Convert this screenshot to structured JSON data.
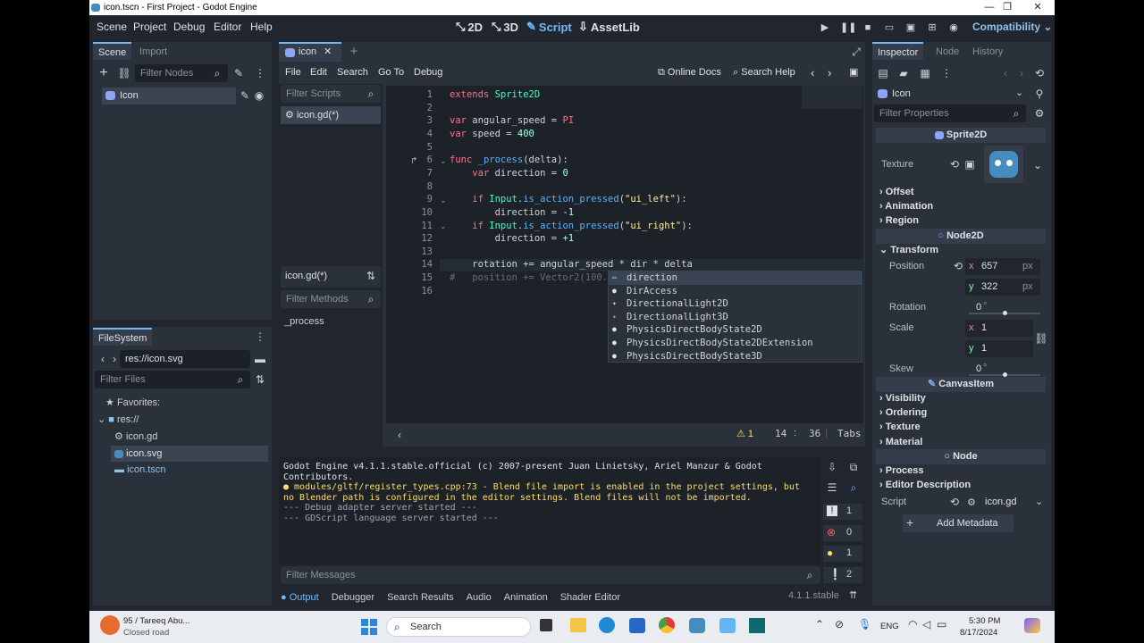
{
  "window": {
    "title": "icon.tscn - First Project - Godot Engine"
  },
  "menu": [
    "Scene",
    "Project",
    "Debug",
    "Editor",
    "Help"
  ],
  "workspaces": {
    "w2d": "2D",
    "w3d": "3D",
    "script": "Script",
    "assetlib": "AssetLib"
  },
  "renderer": "Compatibility",
  "scene_dock": {
    "tab_scene": "Scene",
    "tab_import": "Import",
    "filter_placeholder": "Filter Nodes",
    "root": "Icon"
  },
  "filesystem": {
    "tab": "FileSystem",
    "path": "res://icon.svg",
    "filter_placeholder": "Filter Files",
    "favorites": "Favorites:",
    "res": "res://",
    "files": [
      "icon.gd",
      "icon.svg",
      "icon.tscn"
    ]
  },
  "script_editor": {
    "tab": "icon",
    "menu": [
      "File",
      "Edit",
      "Search",
      "Go To",
      "Debug"
    ],
    "online_docs": "Online Docs",
    "search_help": "Search Help",
    "filter_scripts": "Filter Scripts",
    "script_item": "icon.gd(*)",
    "current_script": "icon.gd(*)",
    "filter_methods": "Filter Methods",
    "method": "_process",
    "status": {
      "warnings": "1",
      "line": "14",
      "sep": ":",
      "col": "36",
      "indent": "Tabs"
    },
    "code": [
      {
        "n": "1",
        "html": "<span class=\"kw\">extends</span> <span class=\"ty\">Sprite2D</span>"
      },
      {
        "n": "2",
        "html": ""
      },
      {
        "n": "3",
        "html": "<span class=\"kw\">var</span> angular_speed = <span class=\"kw\">PI</span>"
      },
      {
        "n": "4",
        "html": "<span class=\"kw\">var</span> speed = <span class=\"num\">400</span>"
      },
      {
        "n": "5",
        "html": ""
      },
      {
        "n": "6",
        "html": "<span class=\"kw\">func</span> <span class=\"fn\">_process</span>(delta):"
      },
      {
        "n": "7",
        "html": "    <span class=\"kw\">var</span> direction = <span class=\"num\">0</span>"
      },
      {
        "n": "8",
        "html": ""
      },
      {
        "n": "9",
        "html": "    <span class=\"kw\">if</span> <span class=\"ty\">Input</span>.<span class=\"fn\">is_action_pressed</span>(<span class=\"str\">\"ui_left\"</span>):"
      },
      {
        "n": "10",
        "html": "        direction = <span class=\"num\">-1</span>"
      },
      {
        "n": "11",
        "html": "    <span class=\"kw\">if</span> <span class=\"ty\">Input</span>.<span class=\"fn\">is_action_pressed</span>(<span class=\"str\">\"ui_right\"</span>):"
      },
      {
        "n": "12",
        "html": "        direction = <span class=\"num\">+1</span>"
      },
      {
        "n": "13",
        "html": ""
      },
      {
        "n": "14",
        "html": "    rotation += angular_speed * dir * delta"
      },
      {
        "n": "15",
        "html": "<span class=\"cm\">#   position += Vector2(100.</span>"
      },
      {
        "n": "16",
        "html": ""
      }
    ],
    "autocomplete": [
      "direction",
      "DirAccess",
      "DirectionalLight2D",
      "DirectionalLight3D",
      "PhysicsDirectBodyState2D",
      "PhysicsDirectBodyState2DExtension",
      "PhysicsDirectBodyState3D"
    ]
  },
  "output": {
    "lines": [
      {
        "text": "Godot Engine v4.1.1.stable.official (c) 2007-present Juan Linietsky, Ariel Manzur & Godot Contributors.",
        "color": "#dfe1e5"
      },
      {
        "text": "● modules/gltf/register_types.cpp:73 - Blend file import is enabled in the project settings, but no Blender path is configured in the editor settings. Blend files will not be imported.",
        "color": "#ffdd65"
      },
      {
        "text": "--- Debug adapter server started ---",
        "color": "#9ea3ab"
      },
      {
        "text": "--- GDScript language server started ---",
        "color": "#9ea3ab"
      }
    ],
    "counts": [
      "1",
      "0",
      "1",
      "2"
    ],
    "filter_placeholder": "Filter Messages",
    "tabs": [
      "Output",
      "Debugger",
      "Search Results",
      "Audio",
      "Animation",
      "Shader Editor"
    ],
    "version": "4.1.1.stable"
  },
  "inspector": {
    "tabs": [
      "Inspector",
      "Node",
      "History"
    ],
    "object": "Icon",
    "filter_placeholder": "Filter Properties",
    "class_sprite": "Sprite2D",
    "texture_label": "Texture",
    "sprite_sections": [
      "Offset",
      "Animation",
      "Region"
    ],
    "class_node2d": "Node2D",
    "transform": "Transform",
    "position_label": "Position",
    "pos_x": "657",
    "pos_y": "322",
    "px": "px",
    "x": "x",
    "y": "y",
    "rotation_label": "Rotation",
    "rotation_value": "0",
    "deg": "°",
    "scale_label": "Scale",
    "scale_x": "1",
    "scale_y": "1",
    "skew_label": "Skew",
    "skew_value": "0",
    "class_canvas": "CanvasItem",
    "canvas_sections": [
      "Visibility",
      "Ordering",
      "Texture",
      "Material"
    ],
    "class_node": "Node",
    "node_sections": [
      "Process",
      "Editor Description"
    ],
    "script_label": "Script",
    "script_value": "icon.gd",
    "add_metadata": "Add Metadata"
  },
  "taskbar": {
    "weather_temp": "95 / Tareeq Abu...",
    "weather_sub": "Closed road",
    "search": "Search",
    "lang": "ENG",
    "time": "5:30 PM",
    "date": "8/17/2024"
  }
}
